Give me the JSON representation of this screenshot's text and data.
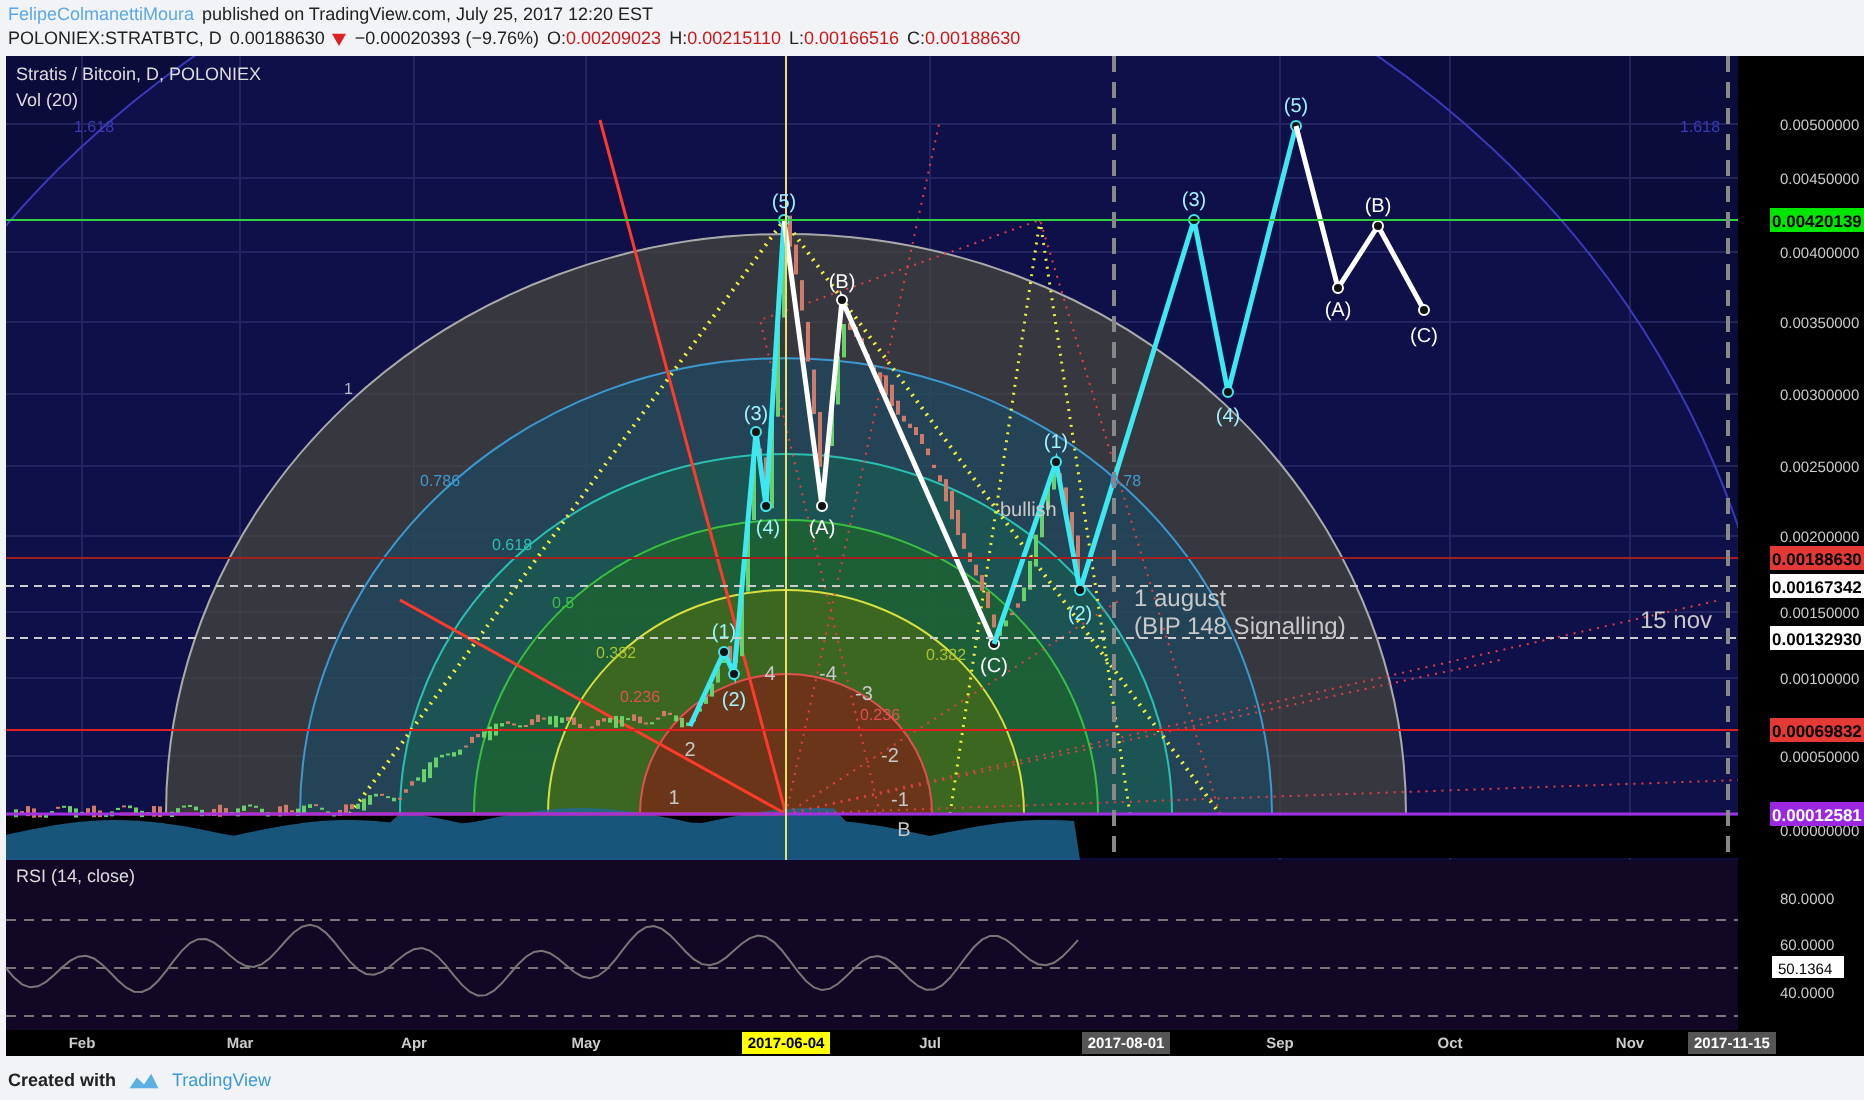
{
  "header": {
    "author": "FelipeColmanettiMoura",
    "published": "published on TradingView.com, July 25, 2017 12:20 EST"
  },
  "quote": {
    "symbol": "POLONIEX:STRATBTC, D",
    "last": "0.00188630",
    "change": "−0.00020393 (−9.76%)",
    "ohlc": [
      {
        "label": "O:",
        "value": "0.00209023"
      },
      {
        "label": "H:",
        "value": "0.00215110"
      },
      {
        "label": "L:",
        "value": "0.00166516"
      },
      {
        "label": "C:",
        "value": "0.00188630"
      }
    ]
  },
  "chart": {
    "legend": [
      "Stratis / Bitcoin, D, POLONIEX",
      "Vol (20)"
    ],
    "price_ticks": [
      "0.00500000",
      "0.00450000",
      "0.00400000",
      "0.00350000",
      "0.00300000",
      "0.00250000",
      "0.00200000",
      "0.00150000",
      "0.00100000",
      "0.00050000",
      "0.00000000"
    ],
    "price_tags": [
      {
        "text": "0.00420139",
        "color": "#00e600"
      },
      {
        "text": "0.00188630",
        "color": "#e53935"
      },
      {
        "text": "0.00167342",
        "color": "#ffffff"
      },
      {
        "text": "0.00132930",
        "color": "#ffffff"
      },
      {
        "text": "0.00069832",
        "color": "#e53935"
      },
      {
        "text": "0.00012581",
        "color": "#9c27e0"
      }
    ],
    "fib_labels": [
      "1.618",
      "1",
      "0.786",
      "0.618",
      "0.5",
      "0.382",
      "0.382",
      "0.236",
      "0.236",
      "0.78",
      "1.618"
    ],
    "fan_labels": [
      "1",
      "2",
      "4",
      "-4",
      "-3",
      "-2",
      "-1",
      "B"
    ],
    "waves": [
      {
        "kind": "impulse",
        "labels": [
          "(1)",
          "(2)",
          "(3)",
          "(4)",
          "(5)"
        ]
      },
      {
        "kind": "correction",
        "labels": [
          "(A)",
          "(B)",
          "(C)"
        ]
      },
      {
        "kind": "impulse",
        "labels": [
          "(1)",
          "(2)",
          "(3)",
          "(4)",
          "(5)"
        ]
      },
      {
        "kind": "correction",
        "labels": [
          "(A)",
          "(B)",
          "(C)"
        ]
      }
    ],
    "notes": [
      "bullish",
      "1 august",
      "(BIP 148 Signalling)",
      "15 nov"
    ]
  },
  "rsi": {
    "title": "RSI (14, close)",
    "ticks": [
      "80.0000",
      "60.0000",
      "40.0000"
    ],
    "tag": "50.1364"
  },
  "time_axis": {
    "labels": [
      "Feb",
      "Mar",
      "Apr",
      "May",
      "Jul",
      "Sep",
      "Oct",
      "Nov"
    ],
    "tags": [
      {
        "text": "2017-06-04",
        "color": "#ffff00"
      },
      {
        "text": "2017-08-01",
        "color": "#555555"
      },
      {
        "text": "2017-11-15",
        "color": "#555555"
      }
    ]
  },
  "footer": {
    "created": "Created with",
    "brand": "TradingView"
  }
}
